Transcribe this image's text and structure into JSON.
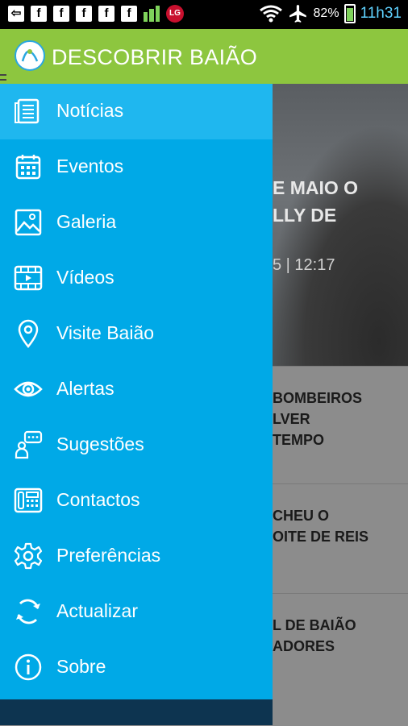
{
  "status_bar": {
    "battery": "82%",
    "time": "11h31",
    "icons": [
      "back-arrow-icon",
      "facebook-icon",
      "facebook-icon",
      "facebook-icon",
      "facebook-icon",
      "facebook-icon",
      "bars-icon",
      "lg-icon",
      "wifi-icon",
      "airplane-icon",
      "battery-icon"
    ]
  },
  "app_bar": {
    "title": "DESCOBRIR BAIÃO",
    "accent_color": "#8dc63f"
  },
  "drawer": {
    "background_color": "#00a9e7",
    "items": [
      {
        "label": "Notícias",
        "icon": "newspaper-icon"
      },
      {
        "label": "Eventos",
        "icon": "calendar-icon"
      },
      {
        "label": "Galeria",
        "icon": "image-icon"
      },
      {
        "label": "Vídeos",
        "icon": "film-icon"
      },
      {
        "label": "Visite Baião",
        "icon": "location-pin-icon"
      },
      {
        "label": "Alertas",
        "icon": "eye-icon"
      },
      {
        "label": "Sugestões",
        "icon": "chat-user-icon"
      },
      {
        "label": "Contactos",
        "icon": "phone-icon"
      },
      {
        "label": "Preferências",
        "icon": "gear-icon"
      },
      {
        "label": "Actualizar",
        "icon": "refresh-icon"
      },
      {
        "label": "Sobre",
        "icon": "info-icon"
      }
    ]
  },
  "background": {
    "hero_title_line1": "E MAIO O",
    "hero_title_line2": "LLY DE",
    "hero_date": "5 | 12:17",
    "news": [
      {
        "line1": "BOMBEIROS",
        "line2": "LVER",
        "line3": "TEMPO"
      },
      {
        "line1": "CHEU O",
        "line2": "OITE DE REIS",
        "line3": ""
      },
      {
        "line1": "L DE BAIÃO",
        "line2": "ADORES",
        "line3": ""
      }
    ]
  }
}
